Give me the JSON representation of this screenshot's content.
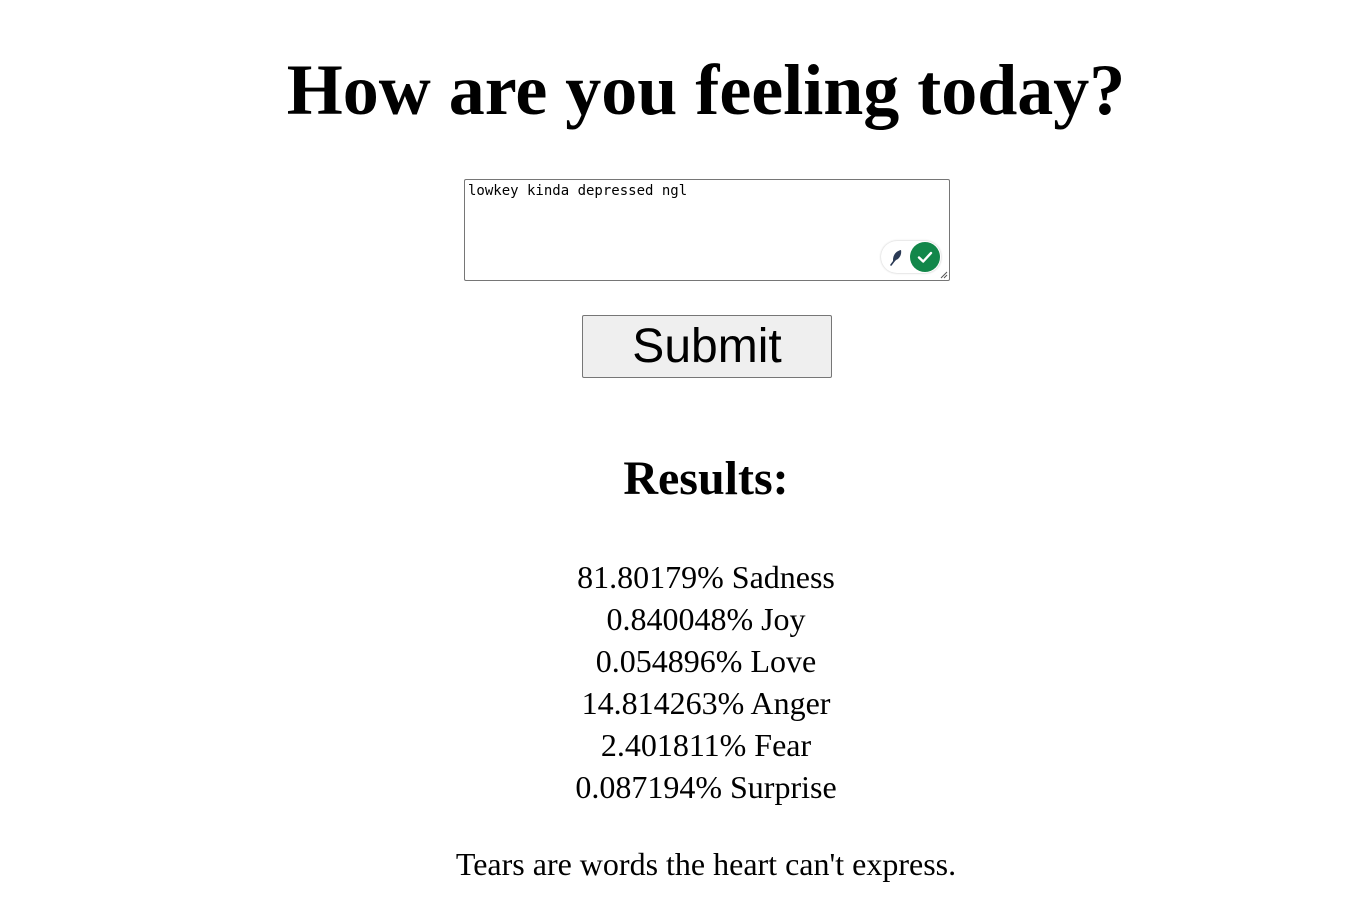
{
  "page": {
    "title": "How are you feeling today?"
  },
  "form": {
    "input_value": "lowkey kinda depressed ngl",
    "submit_label": "Submit"
  },
  "extension": {
    "feather_icon": "feather-icon",
    "check_icon": "check-icon",
    "check_color": "#12874a"
  },
  "results": {
    "heading": "Results:",
    "items": [
      {
        "text": "81.80179% Sadness",
        "percent": 81.80179,
        "emotion": "Sadness"
      },
      {
        "text": "0.840048% Joy",
        "percent": 0.840048,
        "emotion": "Joy"
      },
      {
        "text": "0.054896% Love",
        "percent": 0.054896,
        "emotion": "Love"
      },
      {
        "text": "14.814263% Anger",
        "percent": 14.814263,
        "emotion": "Anger"
      },
      {
        "text": "2.401811% Fear",
        "percent": 2.401811,
        "emotion": "Fear"
      },
      {
        "text": "0.087194% Surprise",
        "percent": 0.087194,
        "emotion": "Surprise"
      }
    ]
  },
  "quote": "Tears are words the heart can't express."
}
